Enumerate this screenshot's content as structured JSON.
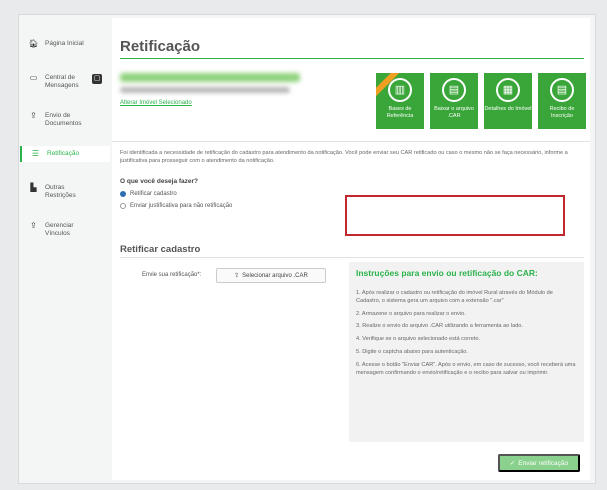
{
  "sidebar": {
    "items": [
      {
        "label": "Página Inicial",
        "icon": "home-icon",
        "glyph": "🏠︎"
      },
      {
        "label": "Central de Mensagens",
        "icon": "inbox-icon",
        "glyph": "▭",
        "badge_icon": "message-icon"
      },
      {
        "label": "Envio de Documentos",
        "icon": "upload-icon",
        "glyph": "⇪"
      },
      {
        "label": "Retificação",
        "icon": "list-icon",
        "glyph": "☰",
        "active": true
      },
      {
        "label": "Outras Restrições",
        "icon": "document-icon",
        "glyph": "▙"
      },
      {
        "label": "Gerenciar Vínculos",
        "icon": "user-icon",
        "glyph": "⇪"
      }
    ]
  },
  "main": {
    "title": "Retificação",
    "property_link": "Alterar Imóvel Selecionado",
    "tiles": [
      {
        "label": "Bases de Referência",
        "icon": "map-icon",
        "glyph": "▥"
      },
      {
        "label": "Baixar o arquivo .CAR",
        "icon": "download-icon",
        "glyph": "▤"
      },
      {
        "label": "Detalhes do Imóvel",
        "icon": "details-icon",
        "glyph": "▦"
      },
      {
        "label": "Recibo de Inscrição",
        "icon": "receipt-icon",
        "glyph": "▤"
      }
    ],
    "description": "Foi identificada a necessidade de retificação do cadastro para atendimento da notificação. Você pode enviar seu CAR retificado ou caso o mesmo não se faça necessário, informe a justificativa para prosseguir com o atendimento da notificação.",
    "question": "O que você deseja fazer?",
    "options": [
      {
        "label": "Retificar cadastro",
        "selected": true
      },
      {
        "label": "Enviar justificativa para não retificação",
        "selected": false
      }
    ],
    "section_title": "Retificar cadastro",
    "upload_label": "Envie sua retificação*:",
    "upload_button": "Selecionar arquivo .CAR",
    "instructions": {
      "title": "Instruções para envio ou retificação do CAR:",
      "steps": [
        "1. Após realizar o cadastro ou retificação do imóvel Rural através do Módulo de Cadastro, o sistema gera um arquivo com a extensão \".car\"",
        "2. Armazene o arquivo para realizar o envio.",
        "3. Realize o envio do arquivo .CAR utilizando a ferramenta ao lado.",
        "4. Verifique se o arquivo selecionado está correto.",
        "5. Digite o captcha abaixo para autenticação.",
        "6. Acesse o botão \"Enviar CAR\". Após o envio, em caso de sucesso, você receberá uma mensagem confirmando o envio/retificação e o recibo para salvar ou imprimir."
      ]
    },
    "submit_button": "Enviar retificação"
  },
  "colors": {
    "accent": "#2bb24c",
    "tile": "#3aa63a",
    "highlight_box": "#c2272d"
  }
}
